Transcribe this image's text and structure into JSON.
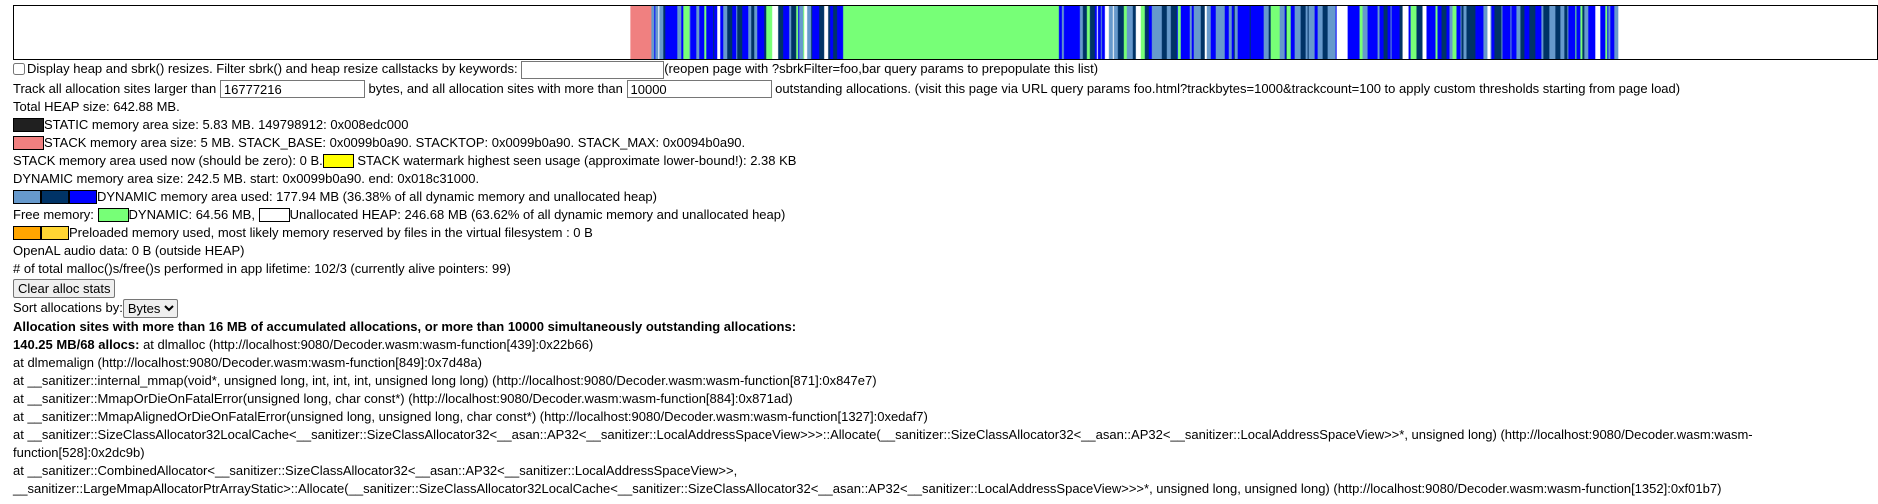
{
  "heap_bar": {
    "segments": [
      {
        "start": 0.0,
        "end": 0.03,
        "color": "#ffffff"
      },
      {
        "start": 0.331,
        "end": 0.342,
        "color": "#f08080"
      },
      {
        "start": 0.342,
        "end": 0.445,
        "kind": "striped"
      },
      {
        "start": 0.445,
        "end": 0.561,
        "color": "#77ff77"
      },
      {
        "start": 0.561,
        "end": 0.861,
        "kind": "striped"
      }
    ],
    "stripe_colors": [
      "#6699cc",
      "#003366",
      "#0000ff",
      "#ffffff",
      "#77ff77"
    ]
  },
  "controls": {
    "display_resizes_label": "Display heap and sbrk() resizes. Filter sbrk() and heap resize callstacks by keywords:",
    "filter_value": "",
    "reopen_hint": "(reopen page with ?sbrkFilter=foo,bar query params to prepopulate this list)",
    "track_prefix": "Track all allocation sites larger than",
    "track_bytes": "16777216",
    "track_mid": "bytes, and all allocation sites with more than",
    "track_count": "10000",
    "track_suffix": "outstanding allocations. (visit this page via URL query params foo.html?trackbytes=1000&trackcount=100 to apply custom thresholds starting from page load)"
  },
  "stats": {
    "total_heap": "Total HEAP size: 642.88 MB.",
    "static_area": "STATIC memory area size: 5.83 MB. 149798912: 0x008edc000",
    "stack_area": "STACK memory area size: 5 MB. STACK_BASE: 0x0099b0a90. STACKTOP: 0x0099b0a90. STACK_MAX: 0x0094b0a90.",
    "stack_used_prefix": "STACK memory area used now (should be zero): 0 B.",
    "stack_watermark": "STACK watermark highest seen usage (approximate lower-bound!): 2.38 KB",
    "dynamic_area": "DYNAMIC memory area size: 242.5 MB. start: 0x0099b0a90. end: 0x018c31000.",
    "dynamic_used": "DYNAMIC memory area used: 177.94 MB (36.38% of all dynamic memory and unallocated heap)",
    "free_prefix": "Free memory:",
    "free_dynamic": "DYNAMIC: 64.56 MB,",
    "free_unallocated": "Unallocated HEAP: 246.68 MB (63.62% of all dynamic memory and unallocated heap)",
    "preloaded": "Preloaded memory used, most likely memory reserved by files in the virtual filesystem : 0 B",
    "openal": "OpenAL audio data: 0 B (outside HEAP)",
    "malloc_count": "# of total malloc()s/free()s performed in app lifetime: 102/3 (currently alive pointers: 99)"
  },
  "colors": {
    "static": "#202020",
    "stack": "#f08080",
    "watermark": "#ffff00",
    "dynamic_1": "#6699cc",
    "dynamic_2": "#003366",
    "dynamic_3": "#0000ff",
    "free_dynamic": "#77ff77",
    "unallocated": "#ffffff",
    "preloaded_1": "#ffa500",
    "preloaded_2": "#ffd633"
  },
  "actions": {
    "clear_button": "Clear alloc stats",
    "sort_label": "Sort allocations by:",
    "sort_selected": "Bytes"
  },
  "alloc": {
    "heading": "Allocation sites with more than 16 MB of accumulated allocations, or more than 10000 simultaneously outstanding allocations:",
    "site_size": "140.25 MB/68 allocs:",
    "frames": [
      " at dlmalloc (http://localhost:9080/Decoder.wasm:wasm-function[439]:0x22b66)",
      "at dlmemalign (http://localhost:9080/Decoder.wasm:wasm-function[849]:0x7d48a)",
      "at __sanitizer::internal_mmap(void*, unsigned long, int, int, int, unsigned long long) (http://localhost:9080/Decoder.wasm:wasm-function[871]:0x847e7)",
      "at __sanitizer::MmapOrDieOnFatalError(unsigned long, char const*) (http://localhost:9080/Decoder.wasm:wasm-function[884]:0x871ad)",
      "at __sanitizer::MmapAlignedOrDieOnFatalError(unsigned long, unsigned long, char const*) (http://localhost:9080/Decoder.wasm:wasm-function[1327]:0xedaf7)",
      "at __sanitizer::SizeClassAllocator32LocalCache<__sanitizer::SizeClassAllocator32<__asan::AP32<__sanitizer::LocalAddressSpaceView>>>::Allocate(__sanitizer::SizeClassAllocator32<__asan::AP32<__sanitizer::LocalAddressSpaceView>>*, unsigned long) (http://localhost:9080/Decoder.wasm:wasm-function[528]:0x2dc9b)",
      "at __sanitizer::CombinedAllocator<__sanitizer::SizeClassAllocator32<__asan::AP32<__sanitizer::LocalAddressSpaceView>>, __sanitizer::LargeMmapAllocatorPtrArrayStatic>::Allocate(__sanitizer::SizeClassAllocator32LocalCache<__sanitizer::SizeClassAllocator32<__asan::AP32<__sanitizer::LocalAddressSpaceView>>>*, unsigned long, unsigned long) (http://localhost:9080/Decoder.wasm:wasm-function[1352]:0xf01b7)"
    ]
  }
}
